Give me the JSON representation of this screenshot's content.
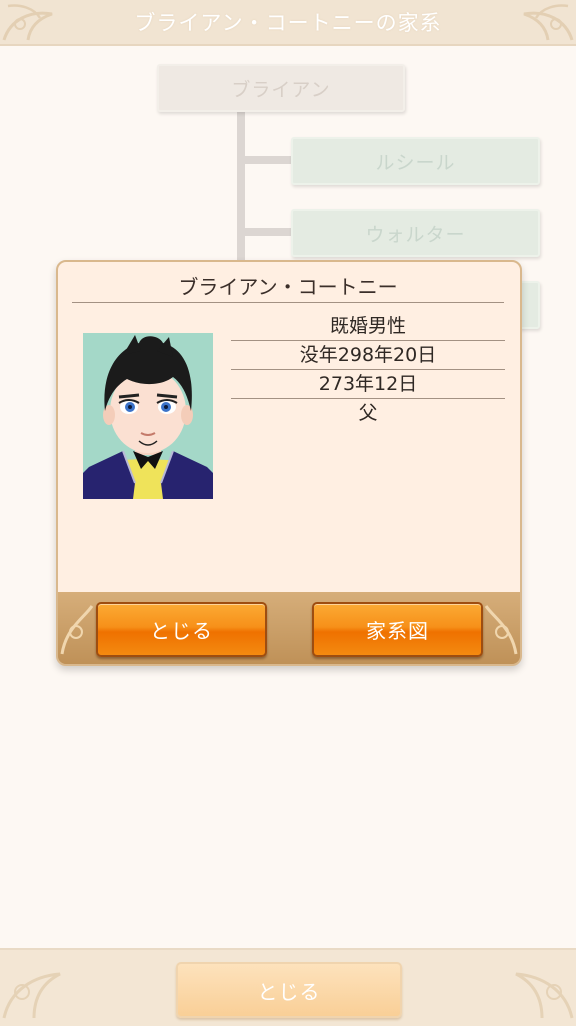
{
  "header": {
    "title": "ブライアン・コートニーの家系"
  },
  "tree": {
    "root": "ブライアン",
    "children": [
      "ルシール",
      "ウォルター",
      ""
    ]
  },
  "dialog": {
    "name": "ブライアン・コートニー",
    "info": [
      "既婚男性",
      "没年298年20日",
      "273年12日",
      "父"
    ],
    "close_label": "とじる",
    "family_tree_label": "家系図"
  },
  "bottom": {
    "close_label": "とじる"
  },
  "icons": {
    "header_ornament": "floral-ornament-icon",
    "portrait": "character-portrait"
  },
  "colors": {
    "accent_orange": "#f58a14",
    "dialog_bg": "#ffefe2",
    "header_bg": "#f1e4d2"
  }
}
